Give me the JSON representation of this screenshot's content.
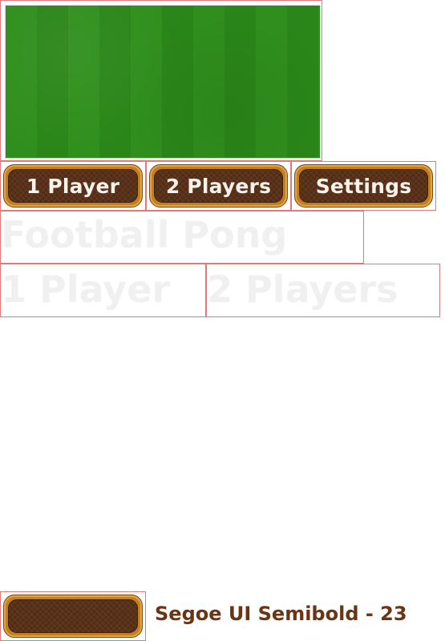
{
  "buttons": {
    "one_player": "1 Player",
    "two_players": "2 Players",
    "settings": "Settings"
  },
  "title": "Football Pong",
  "mode_labels": {
    "one_player": "1 Player",
    "two_players": "2 Players"
  },
  "font_sample_label": "Segoe UI Semibold - 23",
  "colors": {
    "grass": "#2f8f1c",
    "button_frame": "#c47f1e",
    "button_fill": "#5a3118",
    "button_text": "#f7f2ea",
    "font_label": "#6b3412"
  }
}
